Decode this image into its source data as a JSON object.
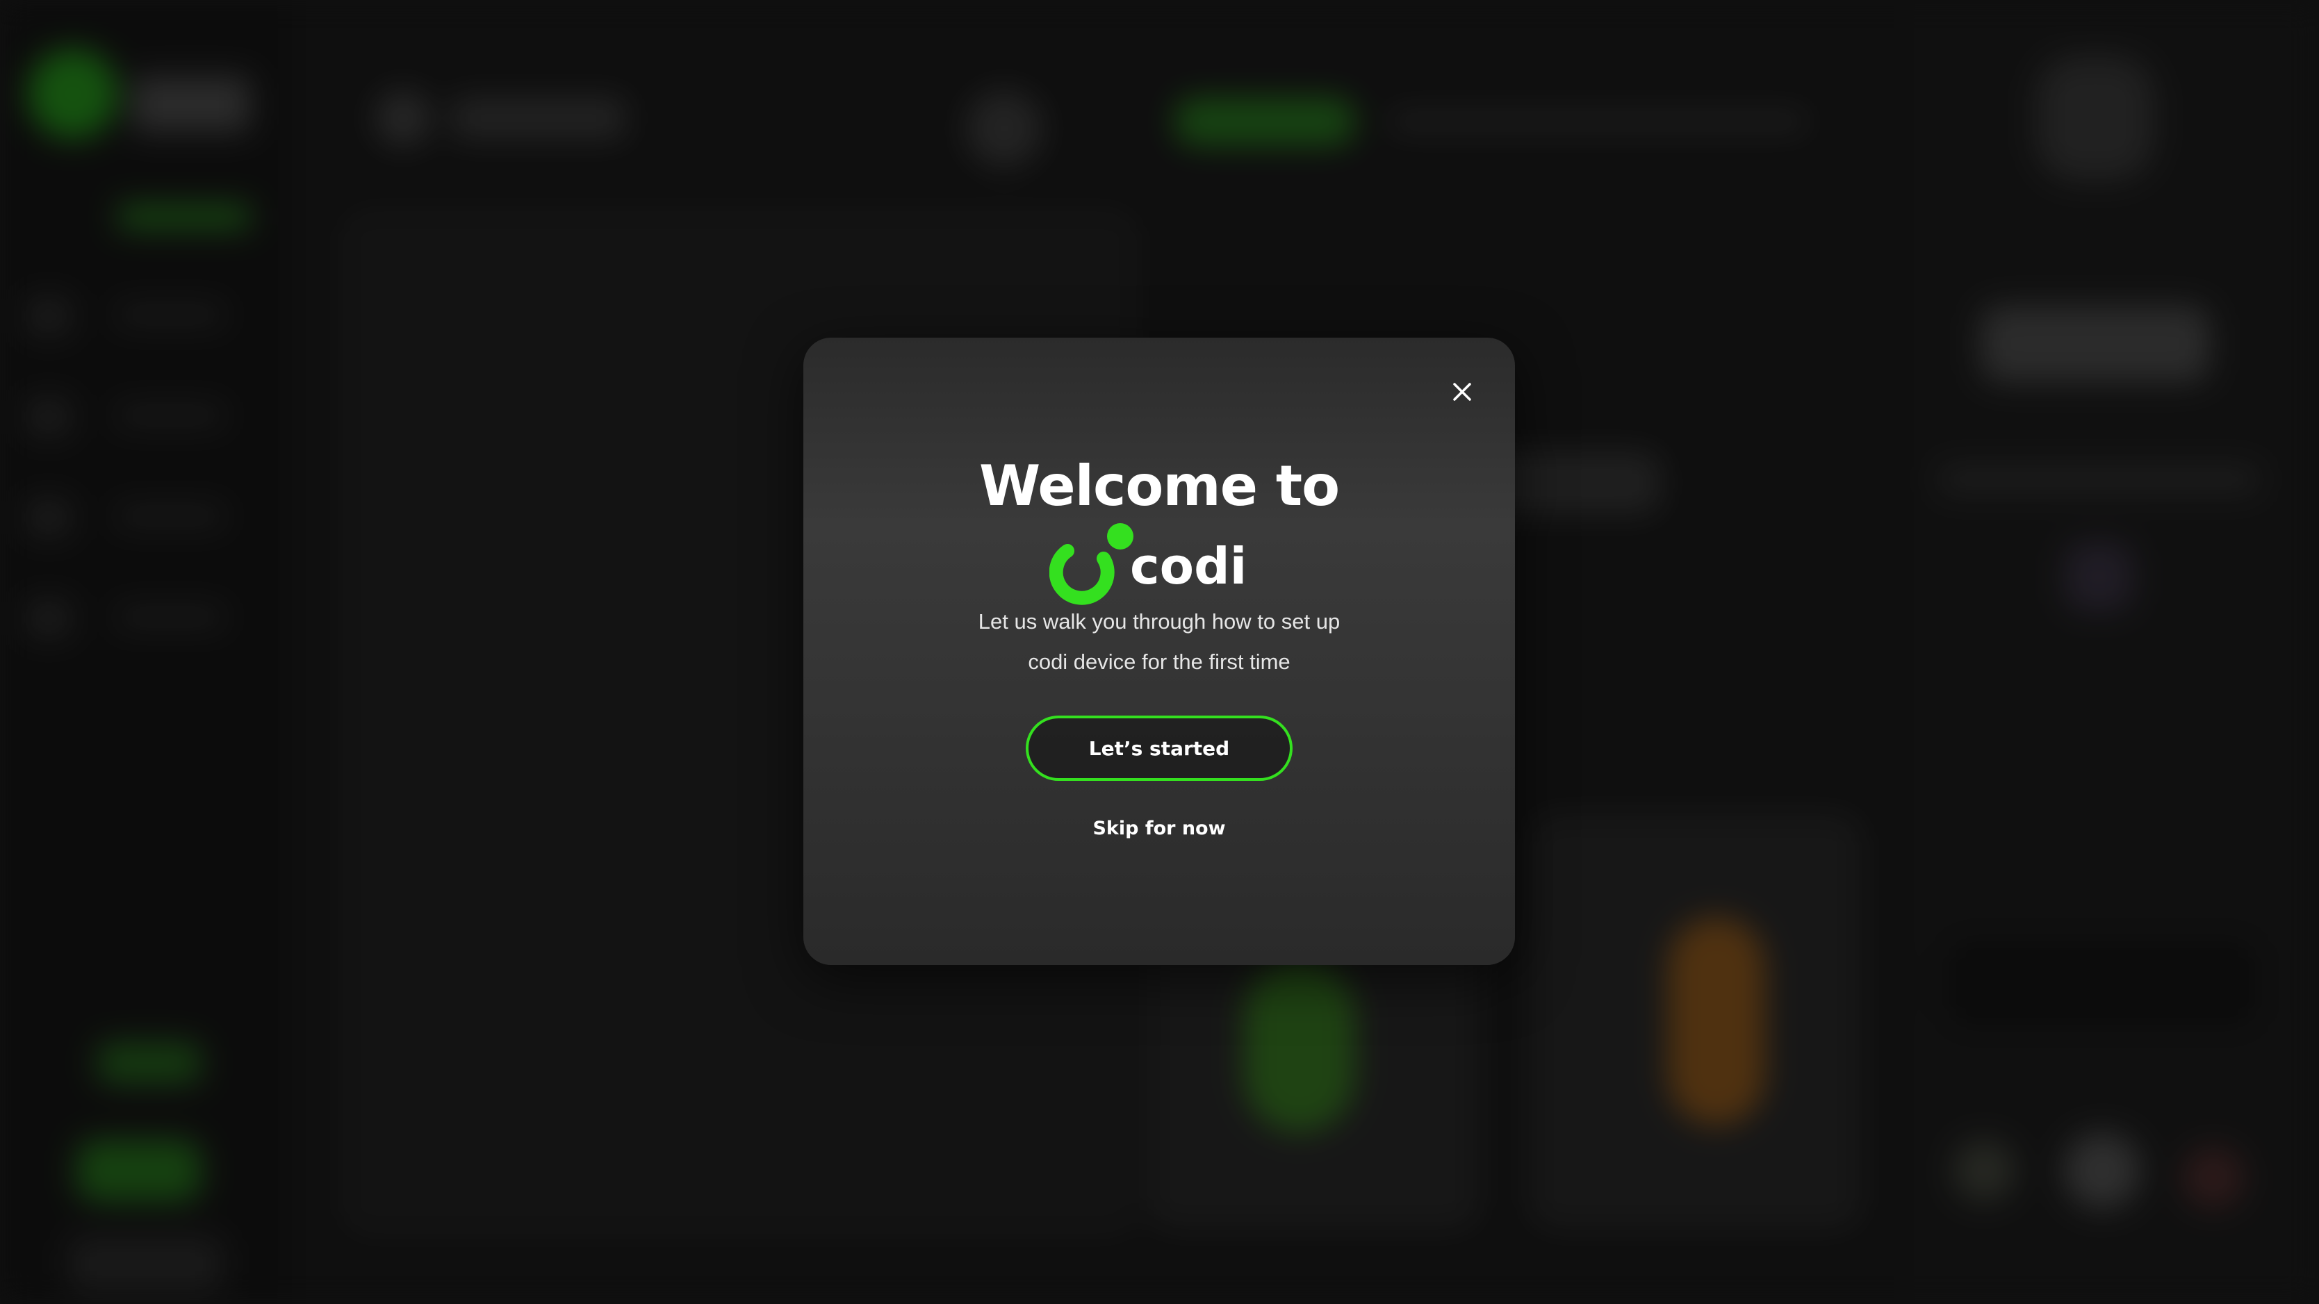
{
  "colors": {
    "accent": "#34e01f",
    "modal_background": "#353535",
    "page_background": "#151515"
  },
  "modal": {
    "close_icon": "close-icon",
    "title": "Welcome to",
    "brand_name": "codi",
    "brand_icon": "codi-logo-icon",
    "subtitle_line1": "Let us walk you through how to set up",
    "subtitle_line2": "codi device for the first time",
    "primary_button_label": "Let’s started",
    "secondary_link_label": "Skip for now"
  }
}
